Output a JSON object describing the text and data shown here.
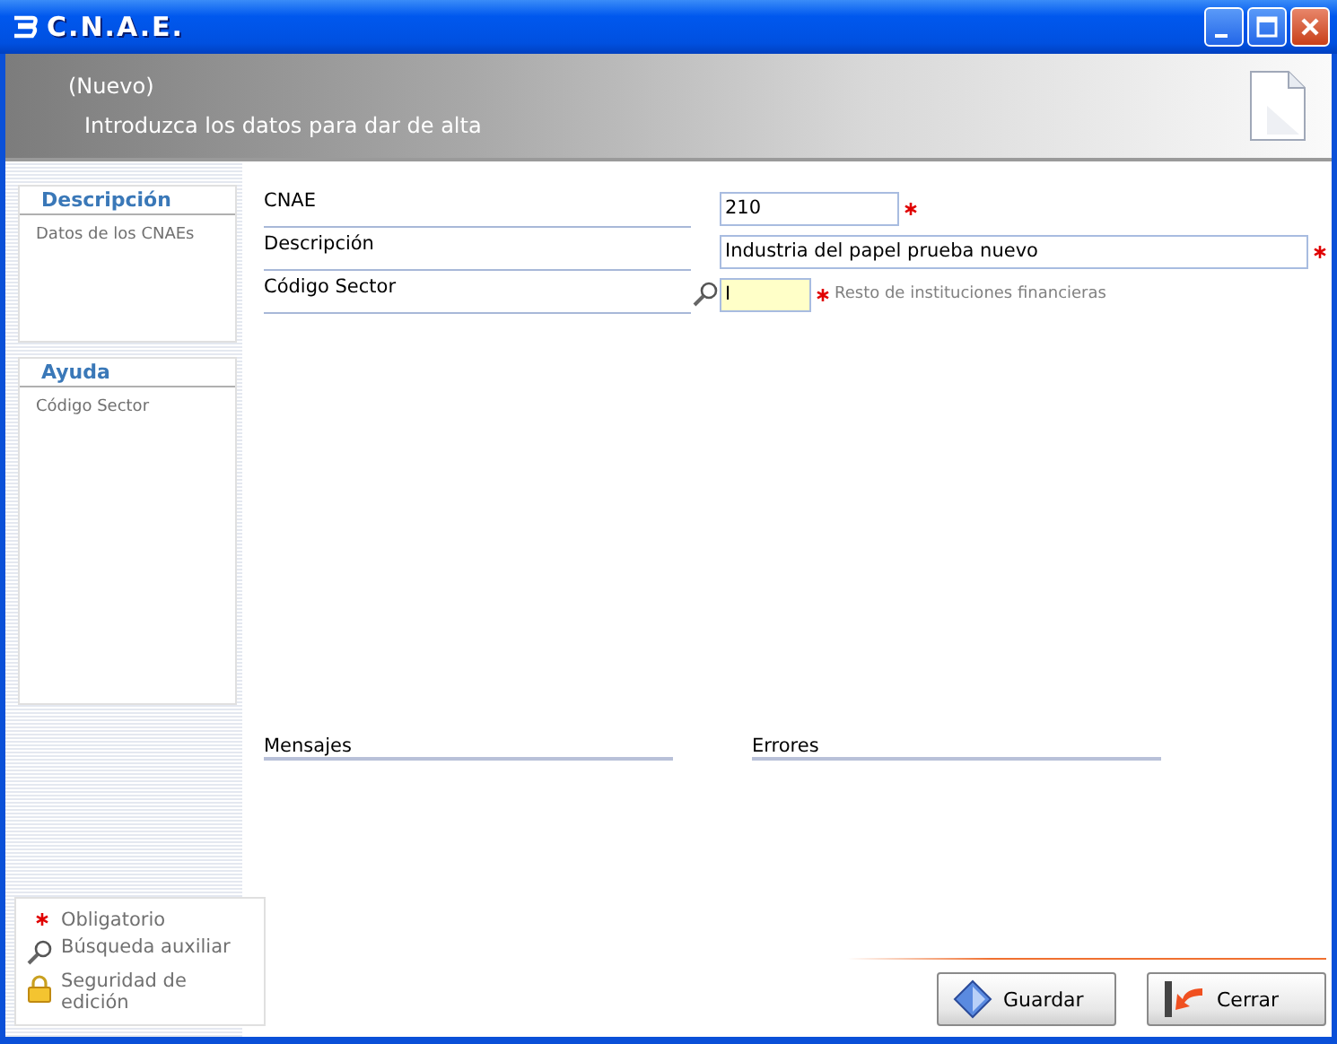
{
  "window": {
    "title": "C.N.A.E."
  },
  "header": {
    "mode": "(Nuevo)",
    "instruction": "Introduzca los datos para dar de alta"
  },
  "sidebar": {
    "panels": [
      {
        "title": "Descripción",
        "text": "Datos de los CNAEs"
      },
      {
        "title": "Ayuda",
        "text": "Código Sector"
      }
    ],
    "legend": [
      {
        "kind": "required",
        "label": "Obligatorio"
      },
      {
        "kind": "search",
        "label": "Búsqueda auxiliar"
      },
      {
        "kind": "lock",
        "label": "Seguridad de edición"
      }
    ]
  },
  "form": {
    "fields": [
      {
        "label": "CNAE",
        "value": "210",
        "required": true,
        "lookup": false,
        "focused": false
      },
      {
        "label": "Descripción",
        "value": "Industria del papel prueba nuevo",
        "required": true,
        "lookup": false,
        "focused": false
      },
      {
        "label": "Código Sector",
        "value": "I",
        "required": true,
        "lookup": true,
        "focused": true,
        "note": "Resto de instituciones financieras"
      }
    ]
  },
  "sections": [
    {
      "title": "Mensajes"
    },
    {
      "title": "Errores"
    }
  ],
  "buttons": [
    {
      "kind": "save",
      "label": "Guardar"
    },
    {
      "kind": "close",
      "label": "Cerrar"
    }
  ]
}
